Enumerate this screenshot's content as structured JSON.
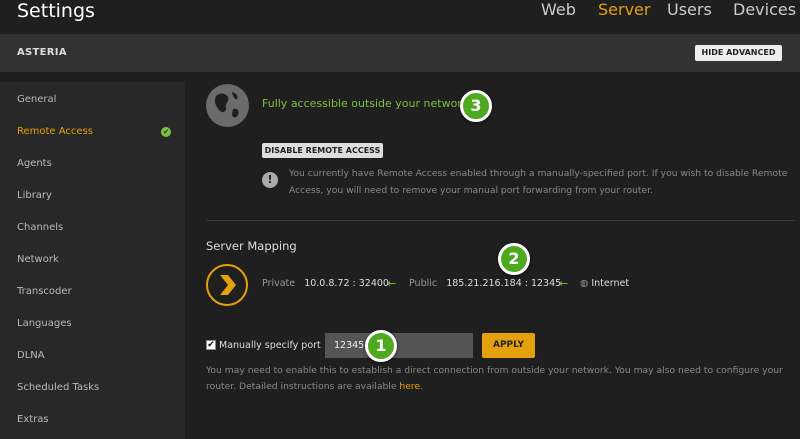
{
  "header": {
    "title": "Settings",
    "tabs": [
      {
        "label": "Web"
      },
      {
        "label": "Server"
      },
      {
        "label": "Users"
      },
      {
        "label": "Devices"
      }
    ],
    "active_tab": "Server"
  },
  "server_bar": {
    "name": "ASTERIA",
    "hide_advanced_label": "HIDE ADVANCED"
  },
  "sidebar": {
    "items": [
      {
        "label": "General"
      },
      {
        "label": "Remote Access"
      },
      {
        "label": "Agents"
      },
      {
        "label": "Library"
      },
      {
        "label": "Channels"
      },
      {
        "label": "Network"
      },
      {
        "label": "Transcoder"
      },
      {
        "label": "Languages"
      },
      {
        "label": "DLNA"
      },
      {
        "label": "Scheduled Tasks"
      },
      {
        "label": "Extras"
      }
    ],
    "active_item": "Remote Access"
  },
  "status": {
    "text": "Fully accessible outside your network",
    "badge": "3",
    "disable_button": "DISABLE REMOTE ACCESS",
    "warning": "You currently have Remote Access enabled through a manually-specified port. If you wish to disable Remote Access, you will need to remove your manual port forwarding from your router."
  },
  "mapping": {
    "title": "Server Mapping",
    "private_label": "Private",
    "private_value": "10.0.8.72 : 32400",
    "public_label": "Public",
    "public_value": "185.21.216.184 : 12345",
    "internet_label": "Internet",
    "badge": "2",
    "arrow_glyph": "←",
    "globe_glyph": "◍"
  },
  "port": {
    "checkbox_label": "Manually specify port",
    "checked": true,
    "value": "12345",
    "badge": "1",
    "apply_label": "APPLY",
    "help_text": "You may need to enable this to establish a direct connection from outside your network. You may also need to configure your router. Detailed instructions are available ",
    "help_link": "here",
    "help_end": "."
  },
  "colors": {
    "accent": "#e5a00d",
    "success": "#7bc142",
    "badge": "#4ea91f"
  }
}
